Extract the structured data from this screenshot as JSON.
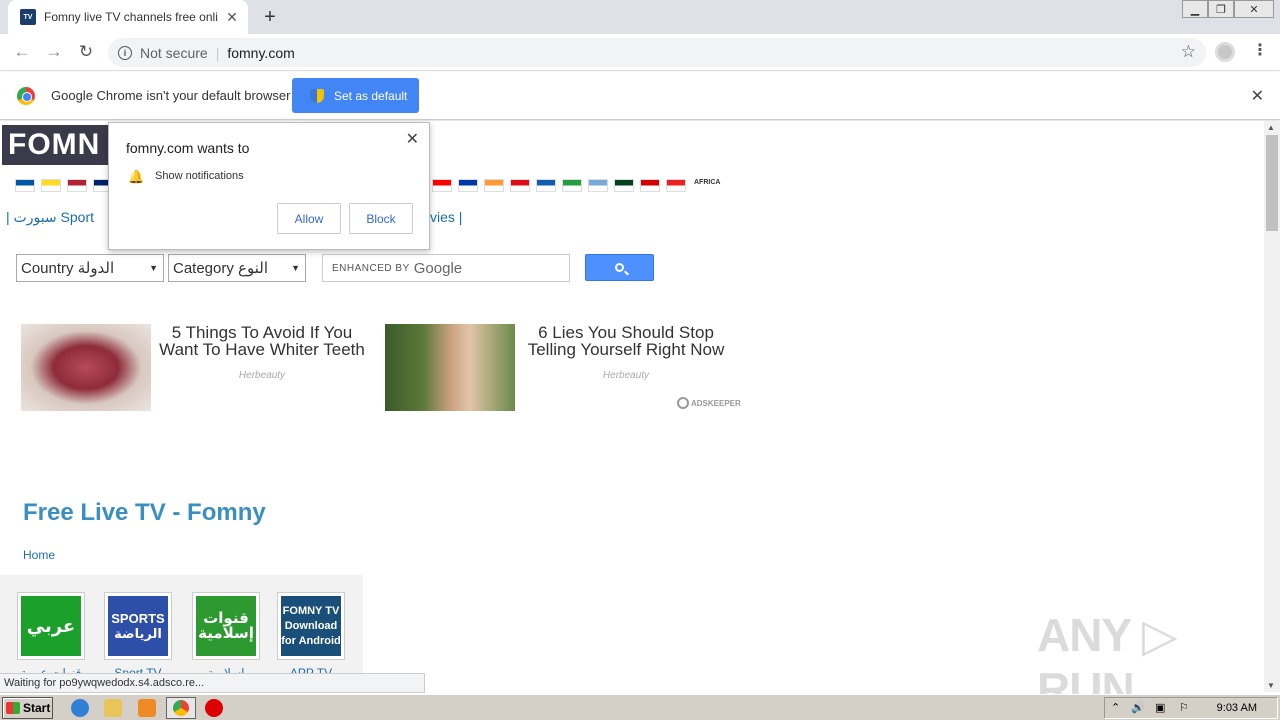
{
  "browser": {
    "tab_title": "Fomny live TV channels free online st",
    "tab_close": "✕",
    "new_tab": "+",
    "not_secure": "Not secure",
    "url": "fomny.com",
    "window_buttons": {
      "minimize": "▁",
      "restore": "❐",
      "close": "✕"
    }
  },
  "infobar": {
    "message": "Google Chrome isn't your default browser",
    "button": "Set as default",
    "close": "✕"
  },
  "notification": {
    "title": "fomny.com wants to",
    "permission": "Show notifications",
    "allow": "Allow",
    "block": "Block",
    "close": "✕"
  },
  "site": {
    "logo": "FOMN",
    "category_links_left": "|  سبورت Sport",
    "category_links_right": "vies   |",
    "country_select": "Country الدولة",
    "category_select": "Category النوع",
    "search_enhanced": "ENHANCED BY",
    "search_google": "Google",
    "flags_left": [
      "#0055a4",
      "#fdda24",
      "#b22234",
      "#012169"
    ],
    "flags_right": [
      "#ff0000",
      "#0039a6",
      "#ff9933",
      "#e30a17",
      "#0d5eaf",
      "#239f40",
      "#75aadb",
      "#01411c",
      "#d20000",
      "#ed2024"
    ],
    "africa_label": "AFRICA",
    "ads": [
      {
        "headline": "5 Things To Avoid If You Want To Have Whiter Teeth",
        "source": "Herbeauty"
      },
      {
        "headline": "6 Lies You Should Stop Telling Yourself Right Now",
        "source": "Herbeauty"
      }
    ],
    "adskeeper": "ADSKEEPER",
    "page_title": "Free Live TV - Fomny",
    "breadcrumb_home": "Home",
    "tiles": [
      {
        "label": "عربي",
        "caption": "قنوات عربية",
        "color": "#1aa02b"
      },
      {
        "label": "SPORTS الرياضة",
        "caption": "Sport TV",
        "color": "#2e4fa8"
      },
      {
        "label": "قنوات إسلامية",
        "caption": "إسلامية",
        "color": "#2d9a31"
      },
      {
        "label": "FOMNY TV Download for Android",
        "caption": "APP TV",
        "color": "#1a4f7a"
      }
    ]
  },
  "status_bar": "Waiting for po9ywqwedodx.s4.adsco.re...",
  "watermark": "ANY ▷ RUN",
  "taskbar": {
    "start": "Start",
    "clock": "9:03 AM"
  },
  "colors": {
    "accent_blue": "#4285f4",
    "link_blue": "#1a6fa8",
    "title_blue": "#3a8fc1"
  }
}
